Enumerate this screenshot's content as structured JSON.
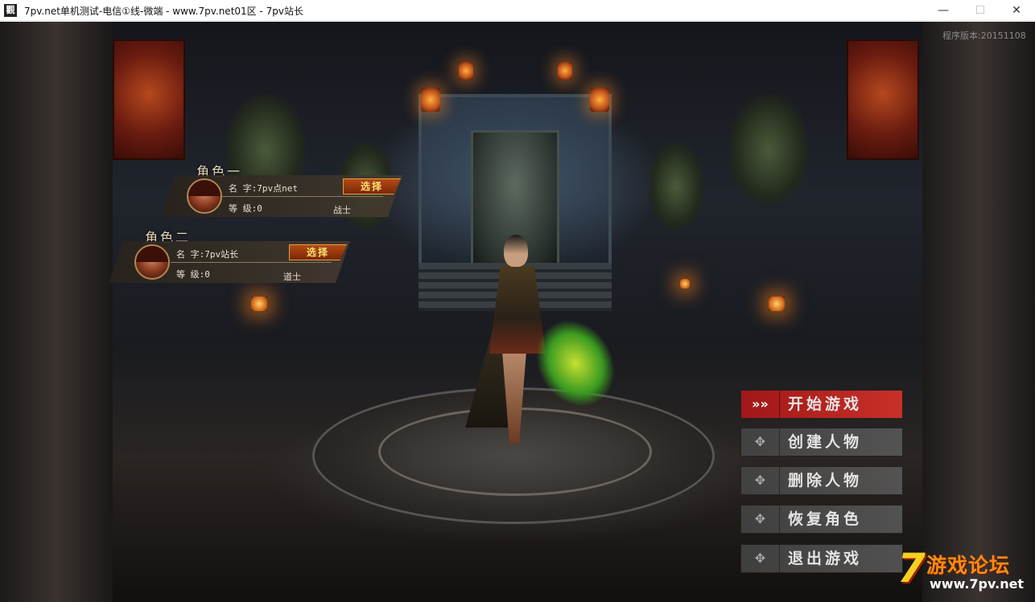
{
  "window": {
    "icon_text": "觀",
    "title": "7pv.net单机测试-电信①线-微端 - www.7pv.net01区 - 7pv站长",
    "minimize_glyph": "—",
    "maximize_glyph": "☐",
    "close_glyph": "✕"
  },
  "version": "程序版本:20151108",
  "roles": [
    {
      "title": "角色一",
      "name": "名 字:7pv点net",
      "level": "等 级:0",
      "class": "战士",
      "select_label": "选择"
    },
    {
      "title": "角色二",
      "name": "名 字:7pv站长",
      "level": "等 级:0",
      "class": "道士",
      "select_label": "选择"
    }
  ],
  "menu": [
    {
      "id": "start",
      "label": "开始游戏",
      "icon": "chevrons-right-icon",
      "glyph": "»»",
      "active": true
    },
    {
      "id": "create",
      "label": "创建人物",
      "icon": "emblem-icon",
      "glyph": "✥"
    },
    {
      "id": "delete",
      "label": "删除人物",
      "icon": "emblem-icon",
      "glyph": "✥"
    },
    {
      "id": "restore",
      "label": "恢复角色",
      "icon": "emblem-icon",
      "glyph": "✥"
    },
    {
      "id": "exit",
      "label": "退出游戏",
      "icon": "emblem-icon",
      "glyph": "✥"
    }
  ],
  "watermark": {
    "digit": "7",
    "text": "游戏论坛",
    "url": "www.7pv.net"
  },
  "colors": {
    "start_button": "#c02a22",
    "menu_button": "#5a5a5a",
    "select_button": "#a0400f",
    "watermark_yellow": "#f4d020",
    "watermark_orange": "#ff8a10"
  }
}
